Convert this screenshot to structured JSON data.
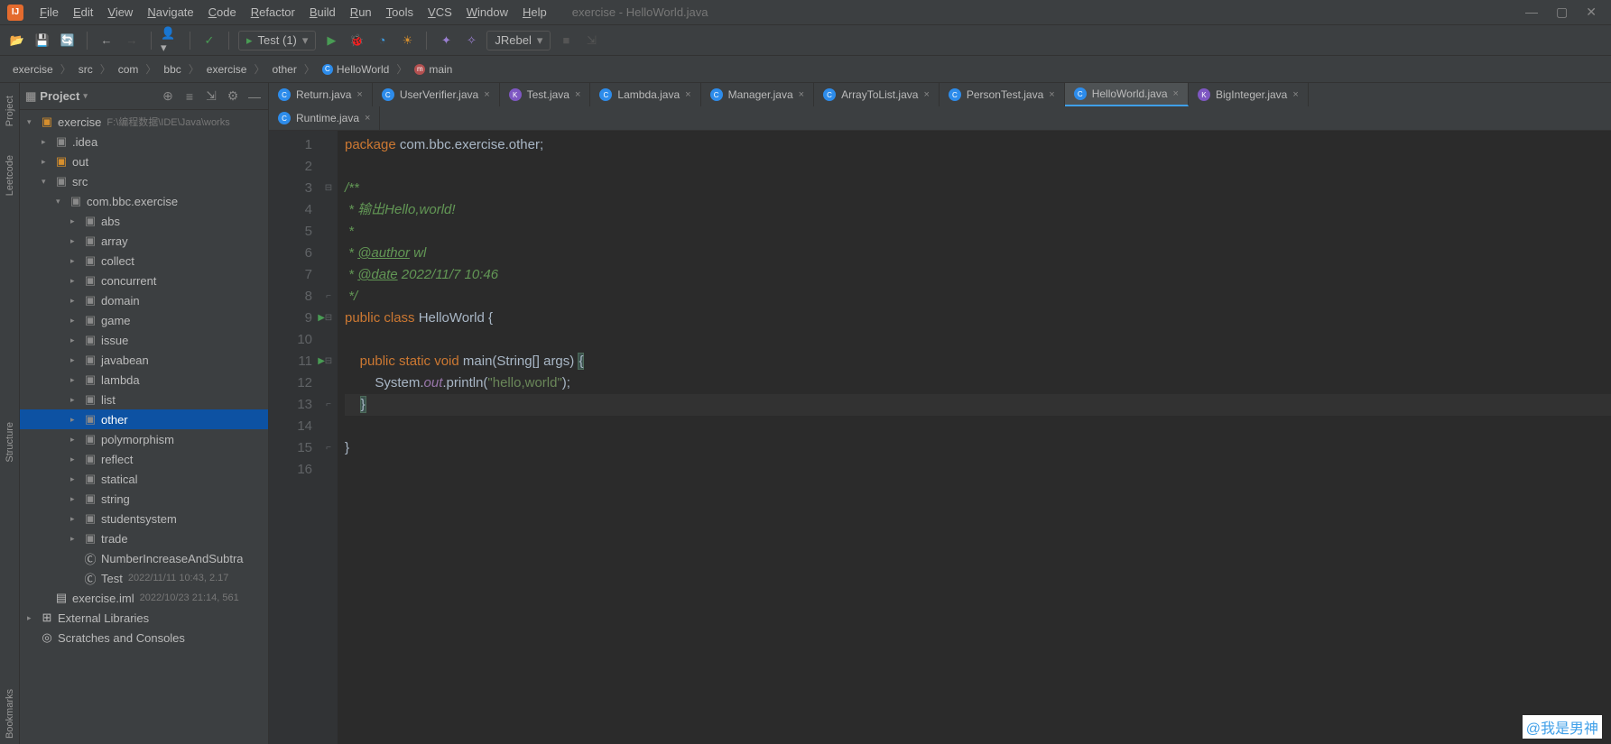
{
  "window_title": "exercise - HelloWorld.java",
  "menu": [
    "File",
    "Edit",
    "View",
    "Navigate",
    "Code",
    "Refactor",
    "Build",
    "Run",
    "Tools",
    "VCS",
    "Window",
    "Help"
  ],
  "toolbar": {
    "run_config": "Test (1)",
    "jrebel": "JRebel"
  },
  "breadcrumb": [
    "exercise",
    "src",
    "com",
    "bbc",
    "exercise",
    "other",
    "HelloWorld",
    "main"
  ],
  "sidebar": {
    "header": "Project",
    "root": {
      "name": "exercise",
      "path": "F:\\编程数据\\IDE\\Java\\works"
    },
    "idea": ".idea",
    "out": "out",
    "src": "src",
    "pkg": "com.bbc.exercise",
    "folders": [
      "abs",
      "array",
      "collect",
      "concurrent",
      "domain",
      "game",
      "issue",
      "javabean",
      "lambda",
      "list",
      "other",
      "polymorphism",
      "reflect",
      "statical",
      "string",
      "studentsystem",
      "trade"
    ],
    "num_inc": "NumberIncreaseAndSubtra",
    "test": {
      "name": "Test",
      "meta": "2022/11/11 10:43, 2.17"
    },
    "iml": {
      "name": "exercise.iml",
      "meta": "2022/10/23 21:14, 561"
    },
    "ext": "External Libraries",
    "scratch": "Scratches and Consoles"
  },
  "tabs_row1": [
    "Return.java",
    "UserVerifier.java",
    "Test.java",
    "Lambda.java",
    "Manager.java",
    "ArrayToList.java",
    "PersonTest.java",
    "HelloWorld.java",
    "BigInteger.java"
  ],
  "tabs_row2": [
    "Runtime.java"
  ],
  "active_tab": "HelloWorld.java",
  "leftbar": [
    "Project",
    "Leetcode",
    "Structure",
    "Bookmarks"
  ],
  "code": {
    "package": "com.bbc.exercise.other",
    "doc_desc": "输出Hello,world!",
    "author_tag": "@author",
    "author": "wl",
    "date_tag": "@date",
    "date": "2022/11/7 10:46",
    "cls": "HelloWorld",
    "main_kw": "public static void",
    "main_name": "main",
    "main_args": "String[] args",
    "body": "System.",
    "out": "out",
    "println": ".println(",
    "msg": "\"hello,world\"",
    "end": ");"
  },
  "lines": [
    "1",
    "2",
    "3",
    "4",
    "5",
    "6",
    "7",
    "8",
    "9",
    "10",
    "11",
    "12",
    "13",
    "14",
    "15",
    "16"
  ],
  "watermark": "@我是男神"
}
